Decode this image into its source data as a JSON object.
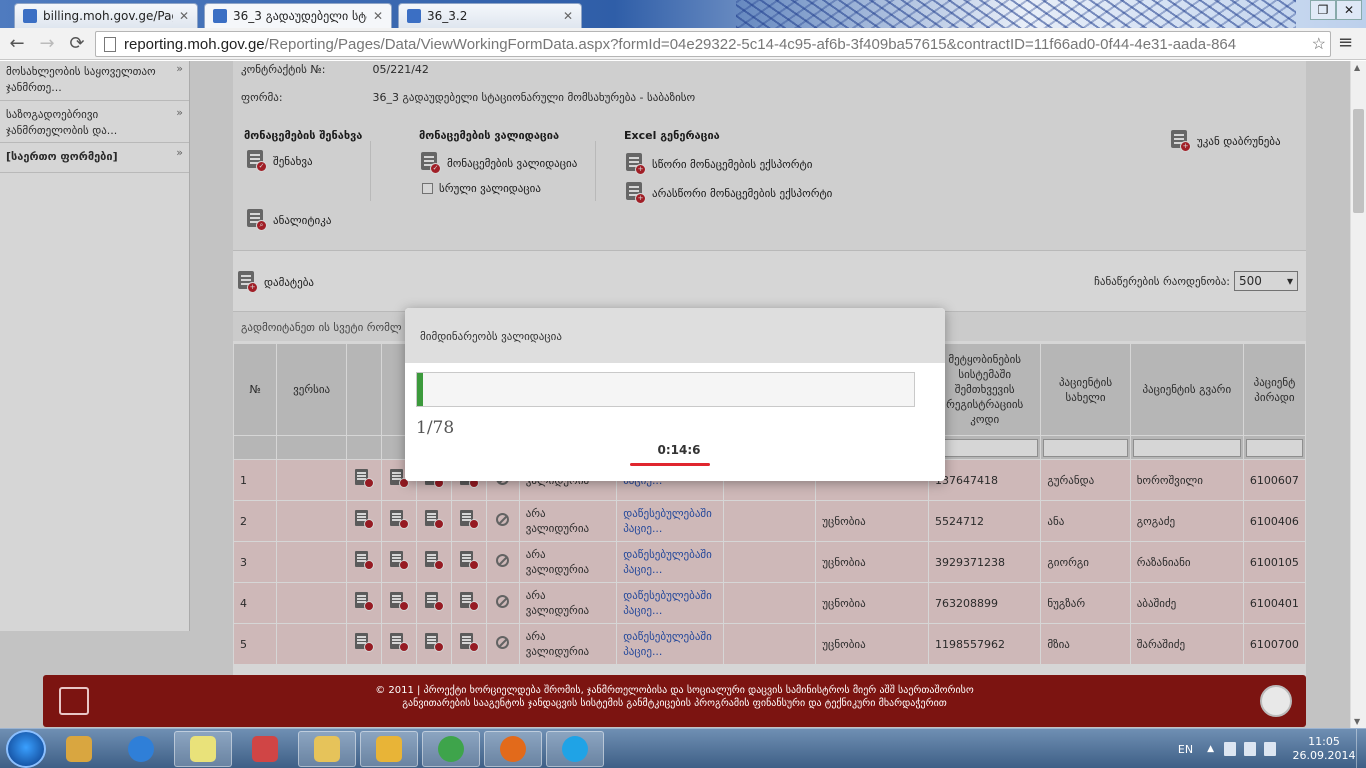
{
  "browser": {
    "tabs": [
      {
        "title": "billing.moh.gov.ge/Pages",
        "active": false
      },
      {
        "title": "36_3 გადაუდებელი სტა",
        "active": true
      },
      {
        "title": "36_3.2",
        "active": false
      }
    ],
    "url_host": "reporting.moh.gov.ge",
    "url_path": "/Reporting/Pages/Data/ViewWorkingFormData.aspx?formId=04e29322-5c14-4c95-af6b-3f409ba57615&contractID=11f66ad0-0f44-4e31-aada-864"
  },
  "sidebar": {
    "items": [
      {
        "label": "მოსახლეობის საყოველთაო ჯანმრთე...",
        "bold": false
      },
      {
        "label": "საზოგადოებრივი ჯანმრთელობის და...",
        "bold": false
      },
      {
        "label": "[საერთო ფორმები]",
        "bold": true
      }
    ]
  },
  "info": {
    "contract_label": "კონტრაქტის №:",
    "contract_value": "05/221/42",
    "form_label": "ფორმა:",
    "form_value": "36_3 გადაუდებელი სტაციონარული მომსახურება - საბაზისო"
  },
  "actions": {
    "save_group": "მონაცემების შენახვა",
    "save_label": "შენახვა",
    "analytics_label": "ანალიტიკა",
    "validate_group": "მონაცემების ვალიდაცია",
    "validate_label": "მონაცემების ვალიდაცია",
    "full_validation_label": "სრული ვალიდაცია",
    "excel_group": "Excel გენერაცია",
    "export_correct_label": "სწორი მონაცემების ექსპორტი",
    "export_incorrect_label": "არასწორი მონაცემების ექსპორტი",
    "back_label": "უკან დაბრუნება",
    "add_label": "დამატება",
    "page_size_label": "ჩანაწერების რაოდენობა:",
    "page_size_value": "500",
    "hint": "გადმოიტანეთ ის სვეტი რომლ"
  },
  "grid": {
    "headers": {
      "num": "№",
      "version": "ვერსია",
      "system_code": "მეტყობინების სისტემაში შემთხვევის რეგისტრაციის კოდი",
      "first_name": "პაციენტის სახელი",
      "last_name": "პაციენტის გვარი",
      "personal_no": "პაციენტ პირადი"
    },
    "rows": [
      {
        "num": "1",
        "status": "ვალიდურია",
        "link": "პაციე...",
        "code": "137647418",
        "first": "გურანდა",
        "last": "ხოროშვილი",
        "pid": "6100607"
      },
      {
        "num": "2",
        "status": "არა ვალიდურია",
        "link": "დაწესებულებაში პაციე...",
        "reason": "უცნობია",
        "code": "5524712",
        "first": "ანა",
        "last": "გოგაძე",
        "pid": "6100406"
      },
      {
        "num": "3",
        "status": "არა ვალიდურია",
        "link": "დაწესებულებაში პაციე...",
        "reason": "უცნობია",
        "code": "3929371238",
        "first": "გიორგი",
        "last": "რაზანიანი",
        "pid": "6100105"
      },
      {
        "num": "4",
        "status": "არა ვალიდურია",
        "link": "დაწესებულებაში პაციე...",
        "reason": "უცნობია",
        "code": "763208899",
        "first": "ნუგზარ",
        "last": "აბაშიძე",
        "pid": "6100401"
      },
      {
        "num": "5",
        "status": "არა ვალიდურია",
        "link": "დაწესებულებაში პაციე...",
        "reason": "უცნობია",
        "code": "1198557962",
        "first": "მზია",
        "last": "შარაშიძე",
        "pid": "6100700"
      }
    ]
  },
  "modal": {
    "title": "მიმდინარეობს ვალიდაცია",
    "count": "1/78",
    "progress": 0.0128,
    "timer": "0:14:6"
  },
  "footer": {
    "line1": "© 2011 | პროექტი ხორციელდება შრომის, ჯანმრთელობისა და სოციალური დაცვის სამინისტროს მიერ აშშ საერთაშორისო",
    "line2": "განვითარების სააგენტოს ჯანდაცვის სისტემის განმტკიცების პროგრამის ფინანსური და ტექნიკური მხარდაჭერით"
  },
  "taskbar": {
    "lang": "EN",
    "time": "11:05",
    "date": "26.09.2014",
    "apps": [
      "paint-icon",
      "ie-icon",
      "notes-icon",
      "snipping-icon",
      "explorer-icon",
      "outlook-icon",
      "chrome-icon",
      "firefox-icon",
      "skype-icon"
    ]
  },
  "colors": {
    "accent_green": "#3c9a3c",
    "footer_red": "#7c1411",
    "row_pink": "#f6dcdc",
    "underline_red": "#e0262e"
  }
}
